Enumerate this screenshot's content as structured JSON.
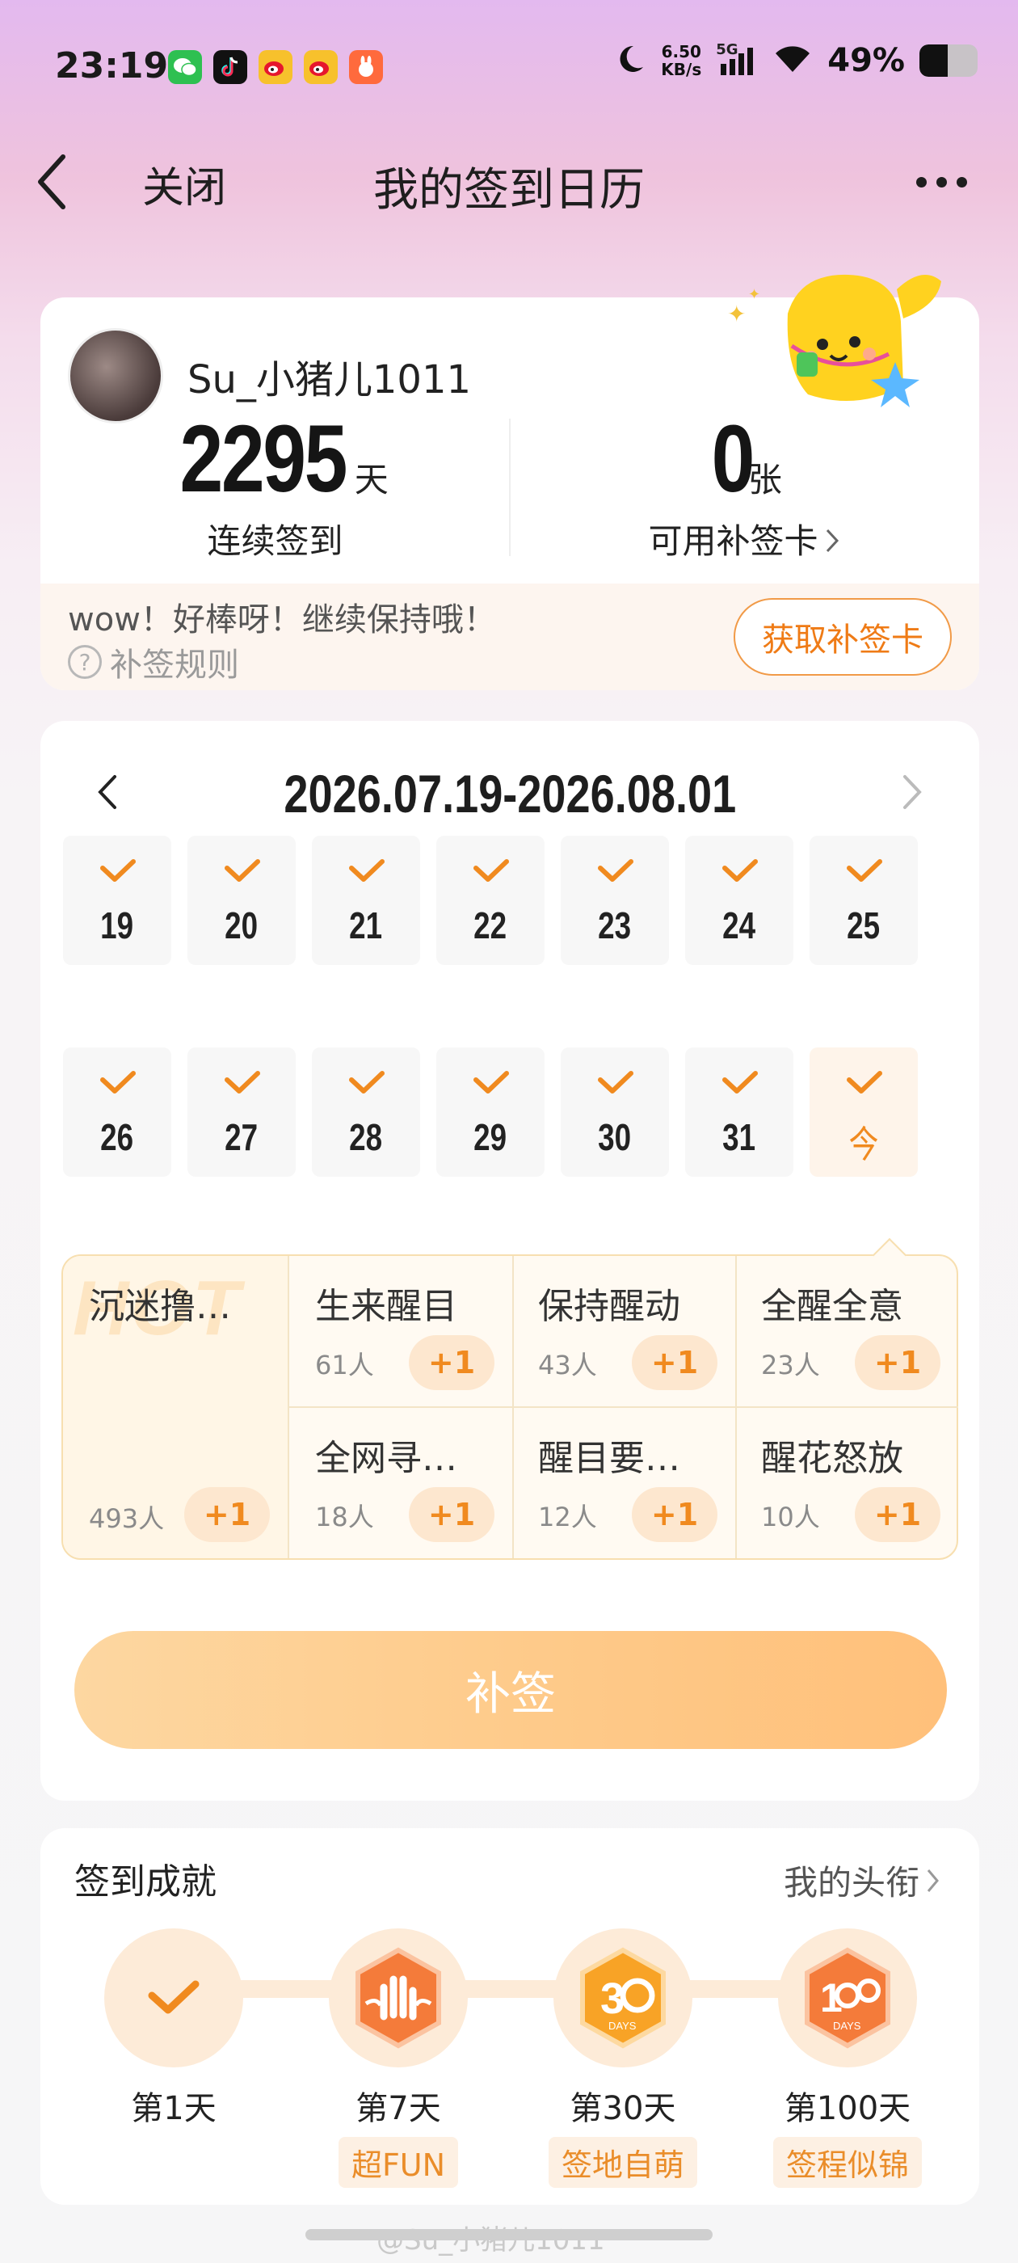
{
  "status_bar": {
    "time": "23:19",
    "app_icons": [
      {
        "name": "wechat-icon",
        "color": "#2ec051",
        "glyph": "●"
      },
      {
        "name": "tiktok-icon",
        "color": "#111111",
        "glyph": "♪"
      },
      {
        "name": "weibo-icon",
        "color": "#f5a623",
        "glyph": "◉"
      },
      {
        "name": "weibo-icon",
        "color": "#f5a623",
        "glyph": "◉"
      },
      {
        "name": "app-icon",
        "color": "#ff6a3d",
        "glyph": "◠"
      }
    ],
    "net_speed": "6.50",
    "net_unit": "KB/s",
    "network": "5G",
    "battery": "49%",
    "battery_level": 0.49
  },
  "nav": {
    "close_label": "关闭",
    "title": "我的签到日历"
  },
  "profile": {
    "username": "Su_小猪儿1011",
    "streak_value": "2295",
    "streak_unit": "天",
    "streak_label": "连续签到",
    "cards_value": "0",
    "cards_unit": "张",
    "cards_label": "可用补签卡",
    "encourage": "wow！好棒呀！继续保持哦！",
    "rules_label": "补签规则",
    "get_card_button": "获取补签卡"
  },
  "calendar": {
    "range": "2026.07.19-2026.08.01",
    "week1": [
      "19",
      "20",
      "21",
      "22",
      "23",
      "24",
      "25"
    ],
    "week2": [
      "26",
      "27",
      "28",
      "29",
      "30",
      "31",
      "今"
    ],
    "accent": "#f08a1f"
  },
  "badges": {
    "hot_watermark": "HOT",
    "hot": {
      "name": "沉迷撸…",
      "count": "493人",
      "plus": "+1"
    },
    "items": [
      {
        "name": "生来醒目",
        "count": "61人",
        "plus": "+1"
      },
      {
        "name": "保持醒动",
        "count": "43人",
        "plus": "+1"
      },
      {
        "name": "全醒全意",
        "count": "23人",
        "plus": "+1"
      },
      {
        "name": "全网寻…",
        "count": "18人",
        "plus": "+1"
      },
      {
        "name": "醒目要…",
        "count": "12人",
        "plus": "+1"
      },
      {
        "name": "醒花怒放",
        "count": "10人",
        "plus": "+1"
      }
    ]
  },
  "makeup_button": "补签",
  "achievements": {
    "title": "签到成就",
    "link": "我的头衔",
    "milestones": [
      {
        "day": "第1天",
        "tag": ""
      },
      {
        "day": "第7天",
        "tag": "超FUN"
      },
      {
        "day": "第30天",
        "tag": "签地自萌"
      },
      {
        "day": "第100天",
        "tag": "签程似锦"
      }
    ]
  },
  "watermark": "@Su_小猪儿1011"
}
